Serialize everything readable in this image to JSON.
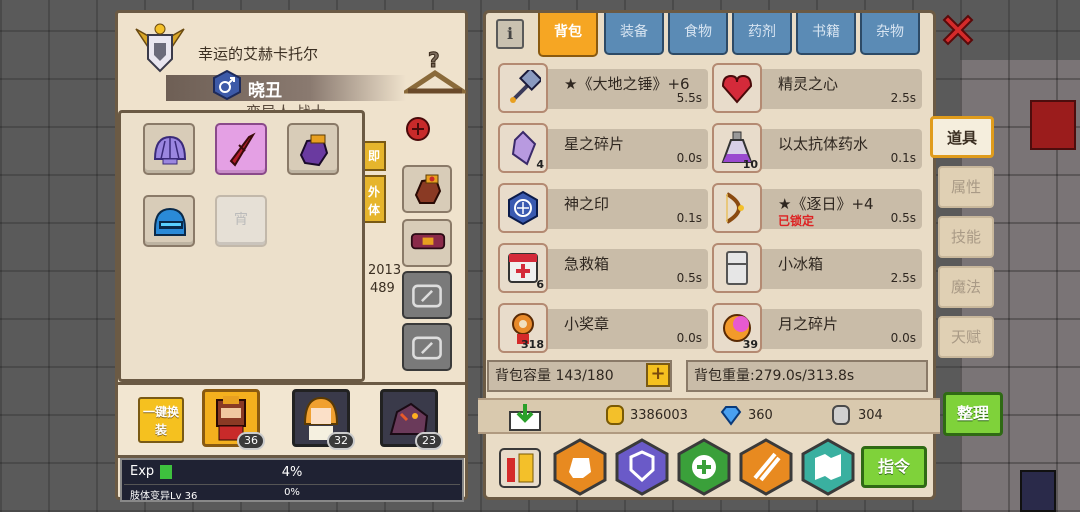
{
  "character": {
    "title": "幸运的艾赫卡托尔",
    "name": "晓丑",
    "subtitle_partial": "变异人 战士",
    "level_partial": "2013",
    "sub_partial": "489"
  },
  "left_tabs": {
    "tab1": "即",
    "tab2": "外体"
  },
  "popup": {
    "empty_slot_label": "宵"
  },
  "team": {
    "one_click_label": "一键换装",
    "members": [
      {
        "level": "36"
      },
      {
        "level": "32"
      },
      {
        "level": "23"
      }
    ]
  },
  "exp": {
    "label": "Exp",
    "percent": "4%",
    "percent_value": 4,
    "body_label": "肢体变异Lv 36",
    "body_percent": "0%"
  },
  "inventory": {
    "info_icon": "info-icon",
    "tabs": [
      "背包",
      "装备",
      "食物",
      "药剂",
      "书籍",
      "杂物"
    ],
    "active_tab": "背包",
    "items": [
      {
        "name": "★《大地之锤》+6",
        "weight": "5.5s",
        "count": "",
        "icon": "hammer-icon"
      },
      {
        "name": "精灵之心",
        "weight": "2.5s",
        "count": "",
        "icon": "heart-icon"
      },
      {
        "name": "星之碎片",
        "weight": "0.0s",
        "count": "4",
        "icon": "crystal-icon"
      },
      {
        "name": "以太抗体药水",
        "weight": "0.1s",
        "count": "10",
        "icon": "potion-icon"
      },
      {
        "name": "神之印",
        "weight": "0.1s",
        "count": "",
        "icon": "seal-icon"
      },
      {
        "name": "★《逐日》+4",
        "weight": "0.5s",
        "count": "",
        "icon": "bow-icon",
        "locked": "已锁定"
      },
      {
        "name": "急救箱",
        "weight": "0.5s",
        "count": "6",
        "icon": "medkit-icon"
      },
      {
        "name": "小冰箱",
        "weight": "2.5s",
        "count": "",
        "icon": "fridge-icon"
      },
      {
        "name": "小奖章",
        "weight": "0.0s",
        "count": "318",
        "icon": "medal-icon"
      },
      {
        "name": "月之碎片",
        "weight": "0.0s",
        "count": "39",
        "icon": "moon-shard-icon"
      }
    ],
    "capacity": "背包容量 143/180",
    "weight": "背包重量:279.0s/313.8s"
  },
  "currency": {
    "gold": "3386003",
    "diamond": "360",
    "silver": "304"
  },
  "buttons": {
    "command": "指令",
    "sort": "整理"
  },
  "side_tabs": [
    "道具",
    "属性",
    "技能",
    "魔法",
    "天赋"
  ],
  "colors": {
    "active_tab": "#f6a623",
    "inactive_tab": "#5b8bb5",
    "confirm_green": "#7fd23a",
    "close_red": "#d42a2a"
  }
}
